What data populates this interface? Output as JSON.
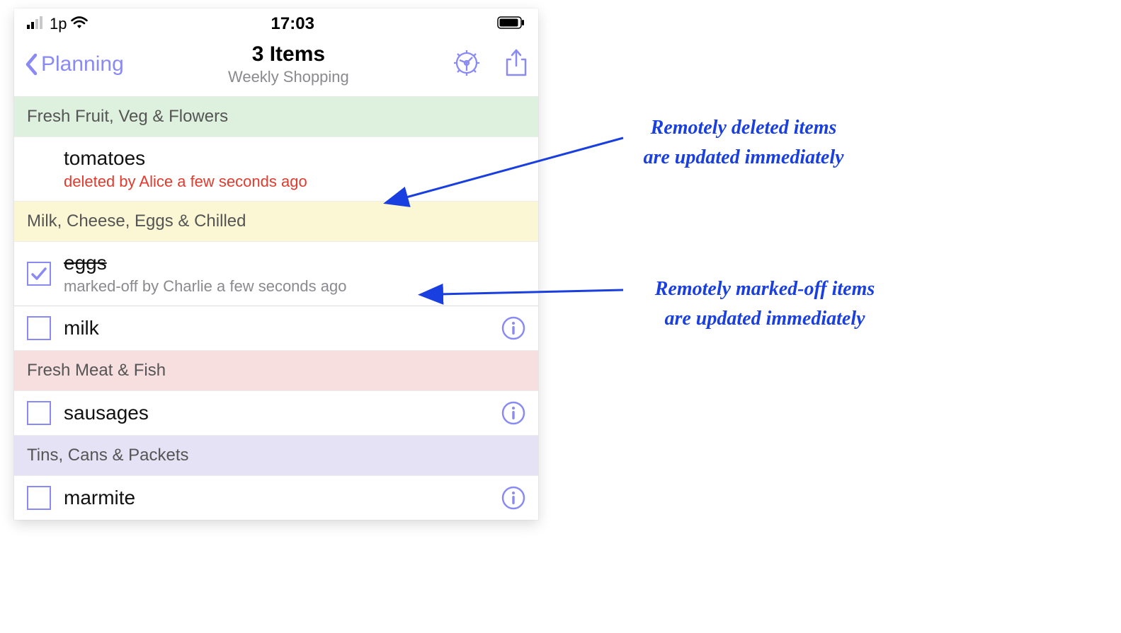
{
  "statusbar": {
    "carrier": "1p",
    "time": "17:03"
  },
  "nav": {
    "back_label": "Planning",
    "title": "3 Items",
    "subtitle": "Weekly Shopping"
  },
  "sections": [
    {
      "header": "Fresh Fruit, Veg & Flowers",
      "header_color": "green",
      "items": [
        {
          "name": "tomatoes",
          "checkbox": "none",
          "status_kind": "deleted",
          "status_text": "deleted by Alice a few seconds ago",
          "show_info": false
        }
      ]
    },
    {
      "header": "Milk, Cheese, Eggs & Chilled",
      "header_color": "yellow",
      "items": [
        {
          "name": "eggs",
          "checkbox": "checked",
          "struck": true,
          "status_kind": "marked",
          "status_text": "marked-off by Charlie a few seconds ago",
          "show_info": false
        },
        {
          "name": "milk",
          "checkbox": "unchecked",
          "show_info": true
        }
      ]
    },
    {
      "header": "Fresh Meat & Fish",
      "header_color": "pink",
      "items": [
        {
          "name": "sausages",
          "checkbox": "unchecked",
          "show_info": true
        }
      ]
    },
    {
      "header": "Tins, Cans & Packets",
      "header_color": "purple",
      "items": [
        {
          "name": "marmite",
          "checkbox": "unchecked",
          "show_info": true
        }
      ]
    }
  ],
  "annotation1": {
    "line1": "Remotely deleted items",
    "line2": "are updated immediately"
  },
  "annotation2": {
    "line1": "Remotely marked-off items",
    "line2": "are updated immediately"
  }
}
